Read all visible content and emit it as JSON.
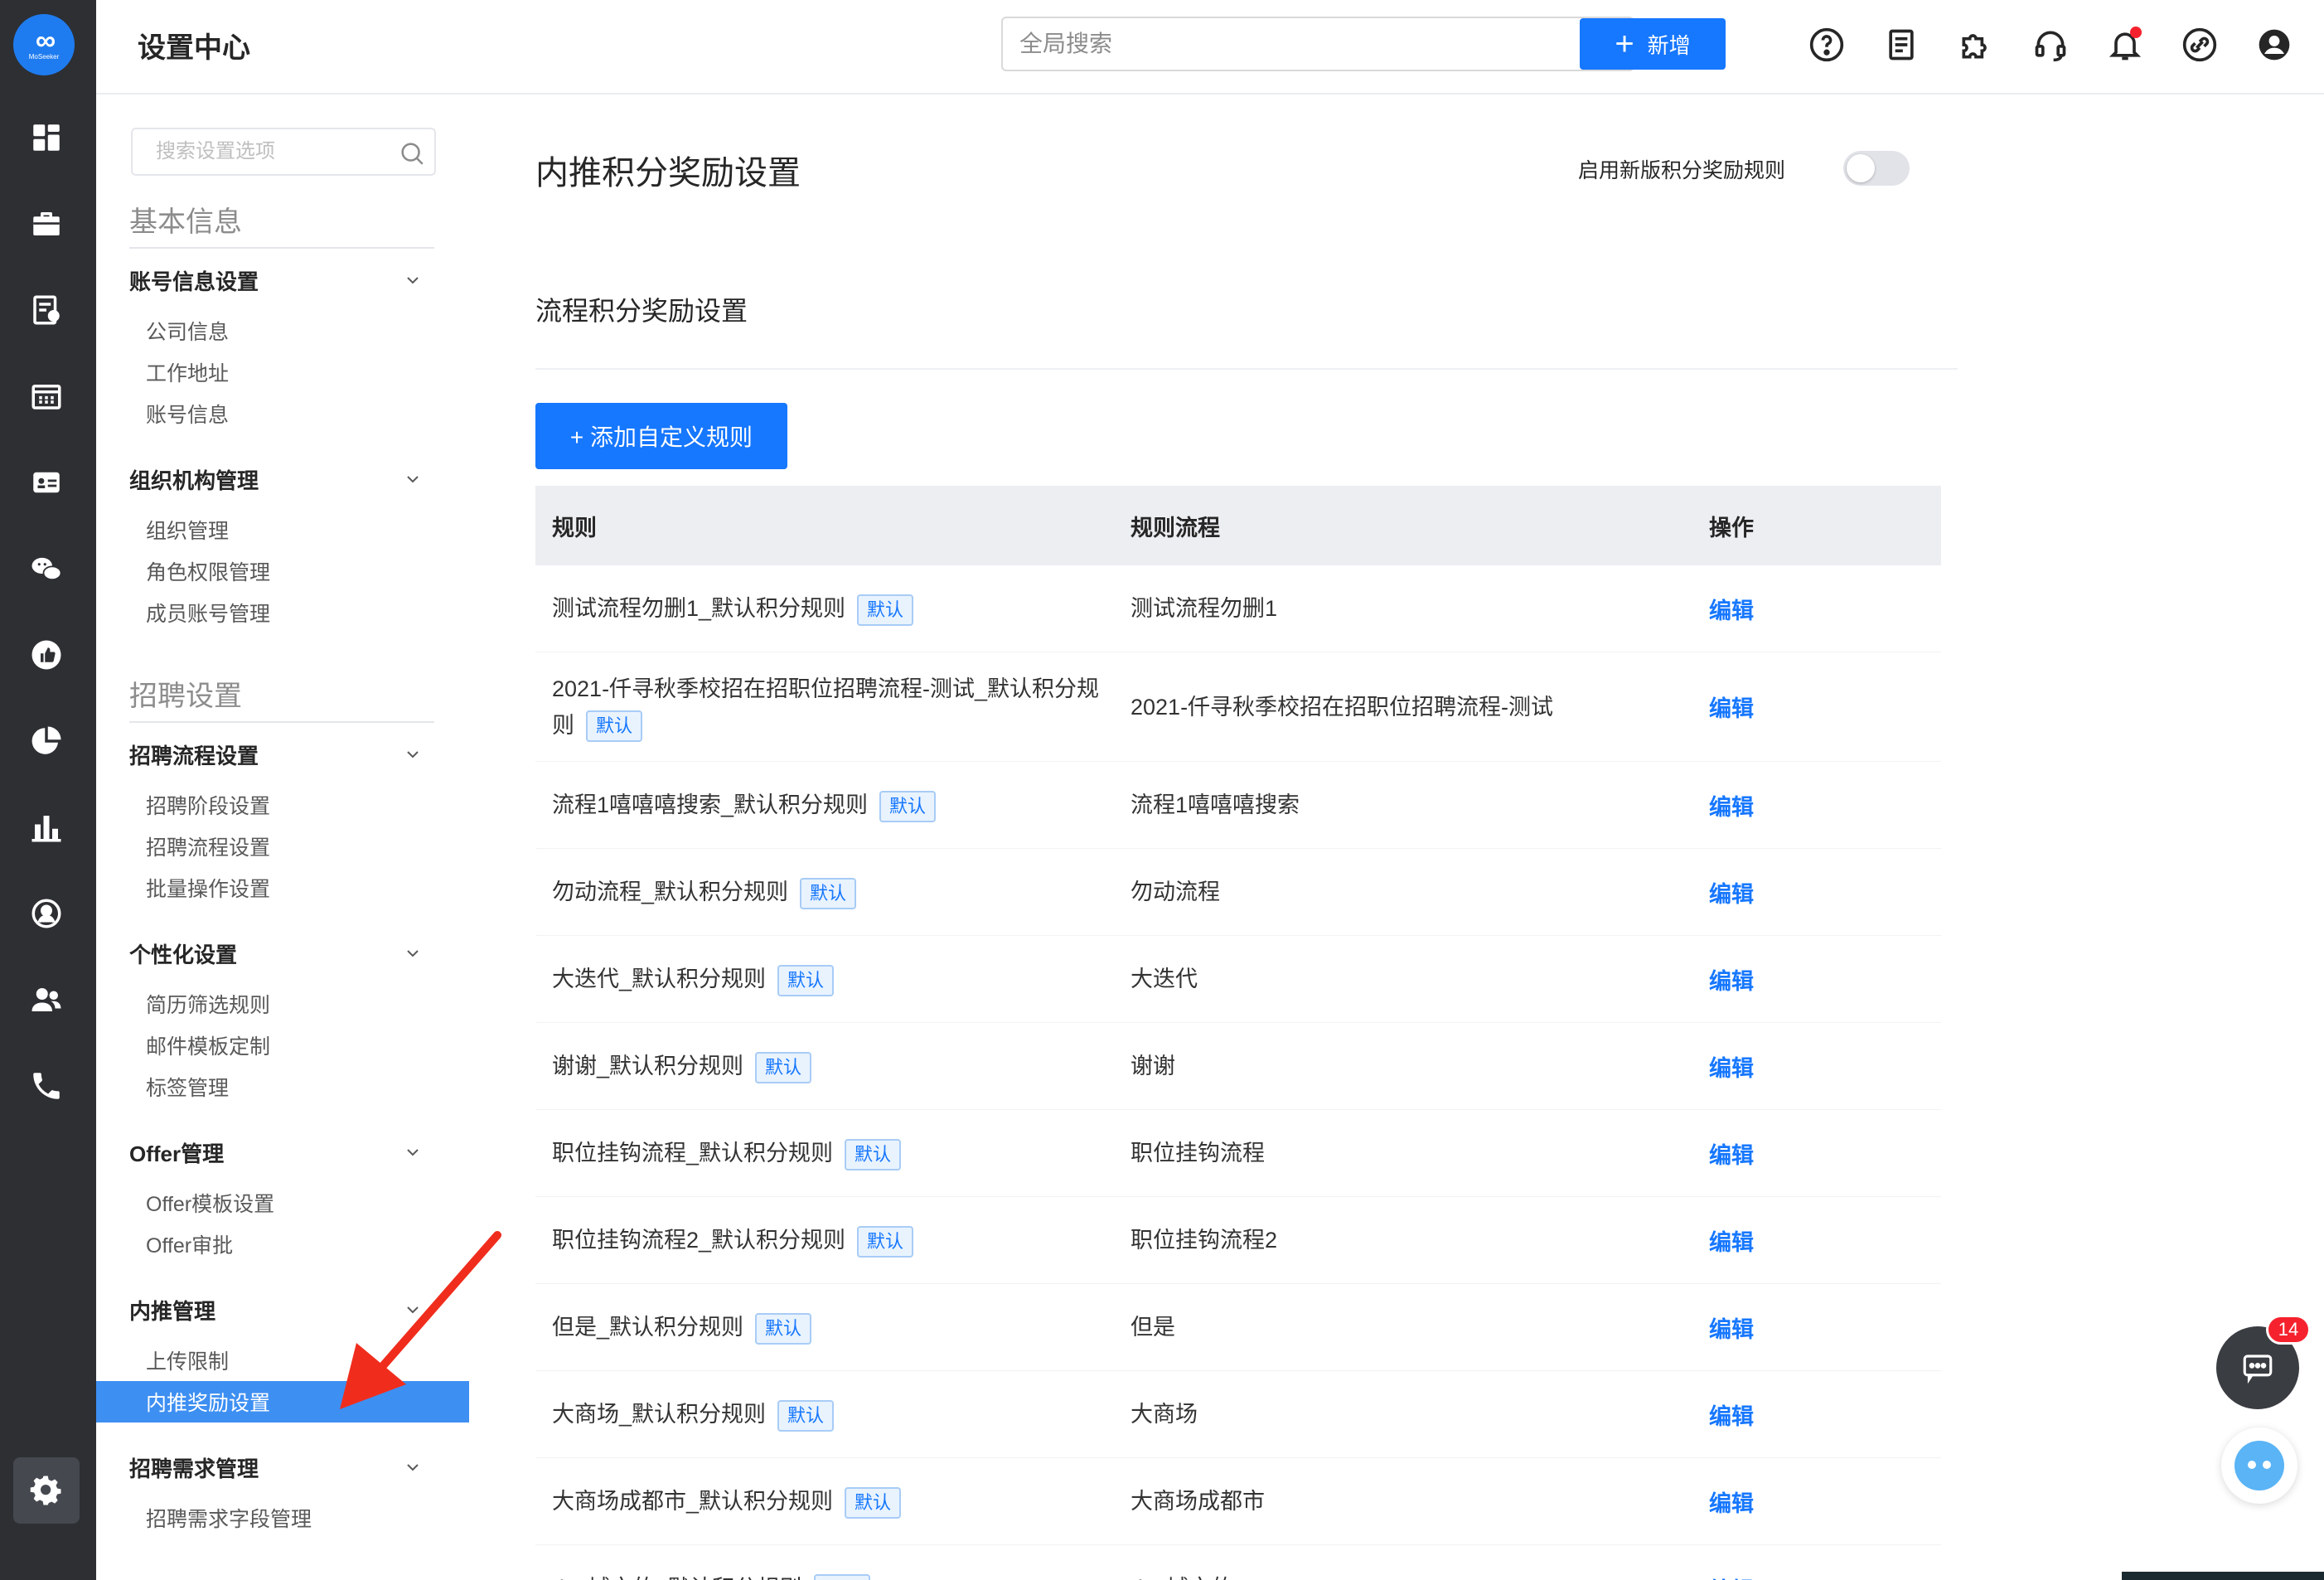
{
  "logo": {
    "mark": "∞",
    "text": "MoSeeker"
  },
  "rail": {
    "icons": [
      "dashboard-icon",
      "briefcase-icon",
      "resume-icon",
      "calendar-icon",
      "id-card-icon",
      "wechat-icon",
      "thumb-up-icon",
      "pie-chart-icon",
      "bar-chart-icon",
      "person-circle-icon",
      "team-icon",
      "phone-icon"
    ],
    "active": "settings-gear-icon"
  },
  "header": {
    "title": "设置中心",
    "search_placeholder": "全局搜索",
    "new_button": "新增",
    "icons": [
      "help-icon",
      "document-icon",
      "plugin-icon",
      "headset-icon",
      "bell-icon",
      "link-icon",
      "user-avatar-icon"
    ]
  },
  "sidebar": {
    "search_placeholder": "搜索设置选项",
    "sections": [
      {
        "title": "基本信息"
      },
      {
        "title": "招聘设置"
      }
    ],
    "groups": [
      {
        "label": "账号信息设置",
        "items": [
          "公司信息",
          "工作地址",
          "账号信息"
        ]
      },
      {
        "label": "组织机构管理",
        "items": [
          "组织管理",
          "角色权限管理",
          "成员账号管理"
        ]
      },
      {
        "label": "招聘流程设置",
        "items": [
          "招聘阶段设置",
          "招聘流程设置",
          "批量操作设置"
        ]
      },
      {
        "label": "个性化设置",
        "items": [
          "简历筛选规则",
          "邮件模板定制",
          "标签管理"
        ]
      },
      {
        "label": "Offer管理",
        "items": [
          "Offer模板设置",
          "Offer审批"
        ]
      },
      {
        "label": "内推管理",
        "items": [
          "上传限制",
          "内推奖励设置"
        ]
      },
      {
        "label": "招聘需求管理",
        "items": [
          "招聘需求字段管理"
        ]
      }
    ],
    "active_item": "内推奖励设置"
  },
  "main": {
    "title": "内推积分奖励设置",
    "toggle_label": "启用新版积分奖励规则",
    "toggle_on": false,
    "section_title": "流程积分奖励设置",
    "add_button": "+ 添加自定义规则",
    "table": {
      "headers": [
        "规则",
        "规则流程",
        "操作"
      ],
      "tag": "默认",
      "action": "编辑",
      "rows": [
        {
          "rule": "测试流程勿删1_默认积分规则",
          "flow": "测试流程勿删1"
        },
        {
          "rule": "2021-仟寻秋季校招在招职位招聘流程-测试_默认积分规则",
          "flow": "2021-仟寻秋季校招在招职位招聘流程-测试"
        },
        {
          "rule": "流程1嘻嘻嘻搜索_默认积分规则",
          "flow": "流程1嘻嘻嘻搜索"
        },
        {
          "rule": "勿动流程_默认积分规则",
          "flow": "勿动流程"
        },
        {
          "rule": "大迭代_默认积分规则",
          "flow": "大迭代"
        },
        {
          "rule": "谢谢_默认积分规则",
          "flow": "谢谢"
        },
        {
          "rule": "职位挂钩流程_默认积分规则",
          "flow": "职位挂钩流程"
        },
        {
          "rule": "职位挂钩流程2_默认积分规则",
          "flow": "职位挂钩流程2"
        },
        {
          "rule": "但是_默认积分规则",
          "flow": "但是"
        },
        {
          "rule": "大商场_默认积分规则",
          "flow": "大商场"
        },
        {
          "rule": "大商场成都市_默认积分规则",
          "flow": "大商场成都市"
        },
        {
          "rule": "des城市的_默认积分规则",
          "flow": "des城市的"
        }
      ]
    }
  },
  "chat": {
    "badge": "14"
  },
  "colors": {
    "accent": "#1677ff",
    "rail_bg": "#2d2f33",
    "active_item_bg": "#3d8ff2",
    "annotation": "#f02d1d"
  }
}
